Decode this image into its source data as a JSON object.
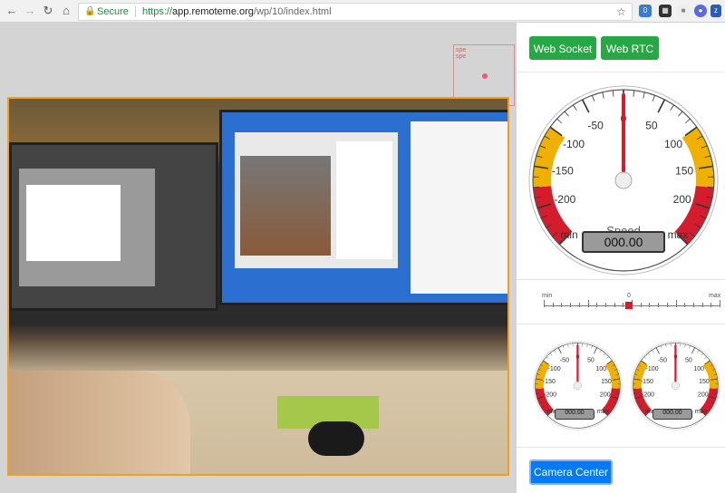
{
  "browser": {
    "secure_label": "Secure",
    "url_scheme": "https://",
    "url_host": "app.remoteme.org",
    "url_path": "/wp/10/index.html"
  },
  "mini_canvas": {
    "label": "speed\nspeed"
  },
  "buttons": {
    "web_socket": "Web Socket",
    "web_rtc": "Web RTC",
    "camera_center": "Camera Center"
  },
  "speed_gauge": {
    "label": "Speed",
    "value_display": "000.00",
    "ticks": [
      "min",
      "-200",
      "-150",
      "-100",
      "-50",
      "0",
      "50",
      "100",
      "150",
      "200",
      "max"
    ],
    "needle_value": 0
  },
  "slider": {
    "min_label": "min",
    "mid_label": "0",
    "max_label": "max",
    "value": 0
  },
  "small_gauges": [
    {
      "label": "left",
      "value_display": "000.00",
      "ticks": [
        "min",
        "-200",
        "-150",
        "-100",
        "-50",
        "0",
        "50",
        "100",
        "150",
        "200",
        "max"
      ]
    },
    {
      "label": "right",
      "value_display": "000.00",
      "ticks": [
        "min",
        "-200",
        "-150",
        "-100",
        "-50",
        "0",
        "50",
        "100",
        "150",
        "200",
        "max"
      ]
    }
  ],
  "colors": {
    "button_green": "#28a745",
    "button_blue": "#007bff",
    "gauge_yellow": "#f0b000",
    "gauge_red": "#d41c2c",
    "video_border": "#f0a020"
  }
}
